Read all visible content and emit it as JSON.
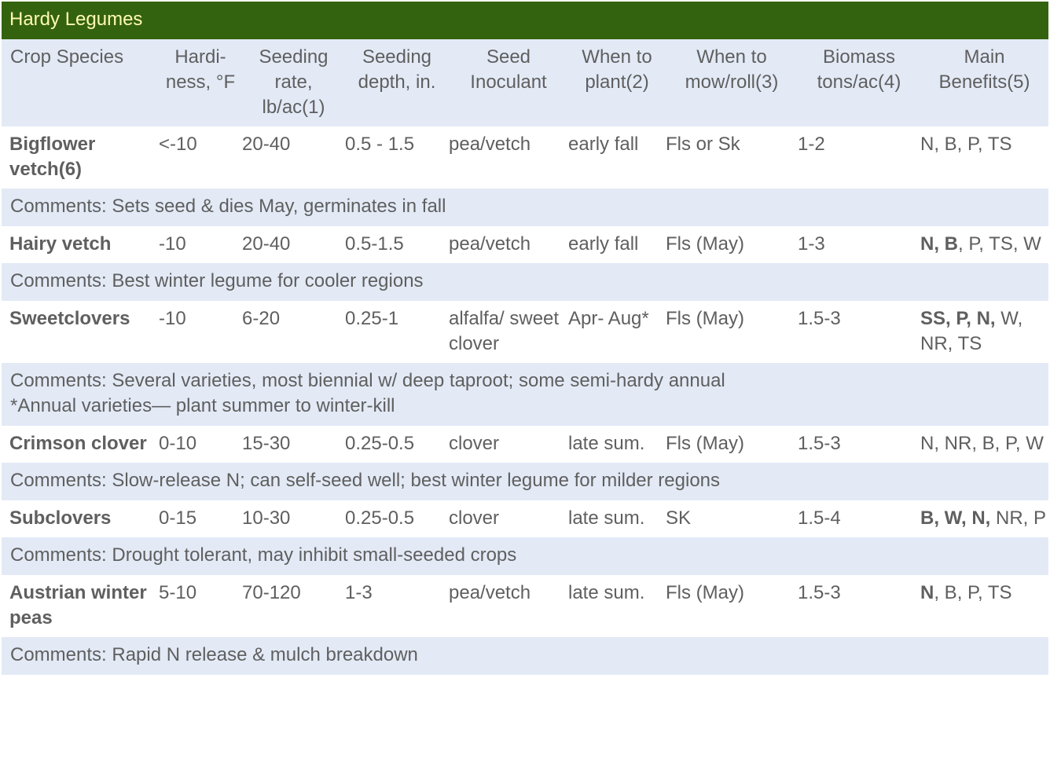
{
  "title": "Hardy Legumes",
  "colors": {
    "title_bg": "#346310",
    "title_text": "#fff9b0",
    "header_bg": "#e3eaf6",
    "comment_bg": "#e3eaf6",
    "text": "#5f5f5f"
  },
  "headers": [
    "Crop Species",
    "Hardi- ness, °F",
    "Seeding rate, lb/ac(1)",
    "Seeding depth, in.",
    "Seed Inoculant",
    "When to plant(2)",
    "When to mow/roll(3)",
    "Biomass tons/ac(4)",
    "Main Benefits(5)"
  ],
  "rows": [
    {
      "crop": "Bigflower vetch(6)",
      "hardiness": "<-10",
      "seeding_rate": "20-40",
      "seeding_depth": "0.5 - 1.5",
      "inoculant": "pea/vetch",
      "when_plant": "early fall",
      "when_mow": "Fls or Sk",
      "biomass": "1-2",
      "benefits_bold": "",
      "benefits_rest": "N, B, P, TS",
      "comment": "Comments: Sets seed & dies May, germinates in fall",
      "comment2": ""
    },
    {
      "crop": "Hairy vetch",
      "hardiness": "-10",
      "seeding_rate": "20-40",
      "seeding_depth": "0.5-1.5",
      "inoculant": "pea/vetch",
      "when_plant": "early fall",
      "when_mow": "Fls (May)",
      "biomass": "1-3",
      "benefits_bold": "N, B",
      "benefits_rest": ", P, TS, W",
      "comment": "Comments: Best winter legume for cooler regions",
      "comment2": ""
    },
    {
      "crop": "Sweetclovers",
      "hardiness": "-10",
      "seeding_rate": "6-20",
      "seeding_depth": "0.25-1",
      "inoculant": "alfalfa/ sweet clover",
      "when_plant": "Apr- Aug*",
      "when_mow": "Fls (May)",
      "biomass": "1.5-3",
      "benefits_bold": "SS, P, N,",
      "benefits_rest": " W, NR, TS",
      "comment": "Comments: Several varieties, most biennial w/ deep taproot; some semi-hardy annual",
      "comment2": "*Annual varieties— plant summer to winter-kill"
    },
    {
      "crop": "Crimson clover",
      "hardiness": "0-10",
      "seeding_rate": "15-30",
      "seeding_depth": "0.25-0.5",
      "inoculant": "clover",
      "when_plant": "late sum.",
      "when_mow": "Fls (May)",
      "biomass": "1.5-3",
      "benefits_bold": "",
      "benefits_rest": "N, NR, B, P, W",
      "comment": "Comments: Slow-release N; can self-seed well; best winter legume for milder regions",
      "comment2": ""
    },
    {
      "crop": "Subclovers",
      "hardiness": "0-15",
      "seeding_rate": "10-30",
      "seeding_depth": "0.25-0.5",
      "inoculant": "clover",
      "when_plant": "late sum.",
      "when_mow": "SK",
      "biomass": "1.5-4",
      "benefits_bold": "B, W, N,",
      "benefits_rest": " NR, P",
      "comment": "Comments: Drought tolerant, may inhibit small-seeded crops",
      "comment2": ""
    },
    {
      "crop": "Austrian winter peas",
      "hardiness": "5-10",
      "seeding_rate": "70-120",
      "seeding_depth": "1-3",
      "inoculant": "pea/vetch",
      "when_plant": "late sum.",
      "when_mow": "Fls (May)",
      "biomass": "1.5-3",
      "benefits_bold": "N",
      "benefits_rest": ", B, P, TS",
      "comment": "Comments: Rapid N release & mulch breakdown",
      "comment2": ""
    }
  ]
}
